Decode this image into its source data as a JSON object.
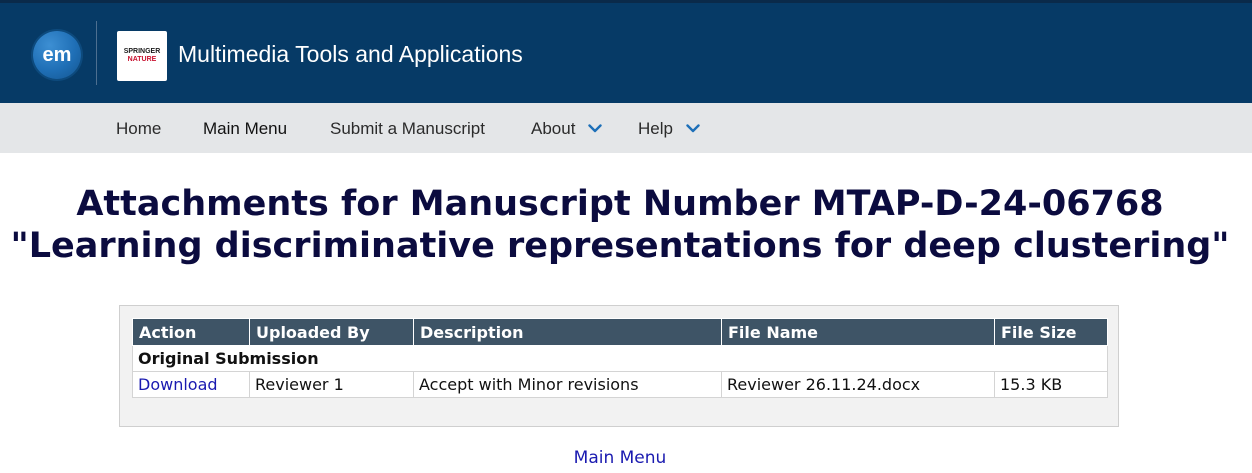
{
  "header": {
    "em_logo_text": "em",
    "publisher_logo_line1": "SPRINGER",
    "publisher_logo_line2": "NATURE",
    "journal_title": "Multimedia Tools and Applications",
    "colors": {
      "background": "#063a66",
      "publisher_red": "#c8102e"
    }
  },
  "nav": {
    "items": [
      {
        "label": "Home",
        "has_dropdown": false
      },
      {
        "label": "Main Menu",
        "has_dropdown": false
      },
      {
        "label": "Submit a Manuscript",
        "has_dropdown": false
      },
      {
        "label": "About",
        "has_dropdown": true
      },
      {
        "label": "Help",
        "has_dropdown": true
      }
    ],
    "chevron_icon": "chevron-down-icon"
  },
  "page": {
    "title_line1": "Attachments for Manuscript Number MTAP-D-24-06768",
    "title_line2": "\"Learning discriminative representations for deep clustering\""
  },
  "table": {
    "headers": [
      "Action",
      "Uploaded By",
      "Description",
      "File Name",
      "File Size"
    ],
    "section_label": "Original Submission",
    "rows": [
      {
        "action": "Download",
        "uploaded_by": "Reviewer 1",
        "description": "Accept with Minor revisions",
        "file_name": "Reviewer 26.11.24.docx",
        "file_size": "15.3 KB"
      }
    ],
    "colors": {
      "header_bg": "#3e5466",
      "link": "#1a1ab0"
    }
  },
  "footer": {
    "main_menu_link": "Main Menu"
  }
}
